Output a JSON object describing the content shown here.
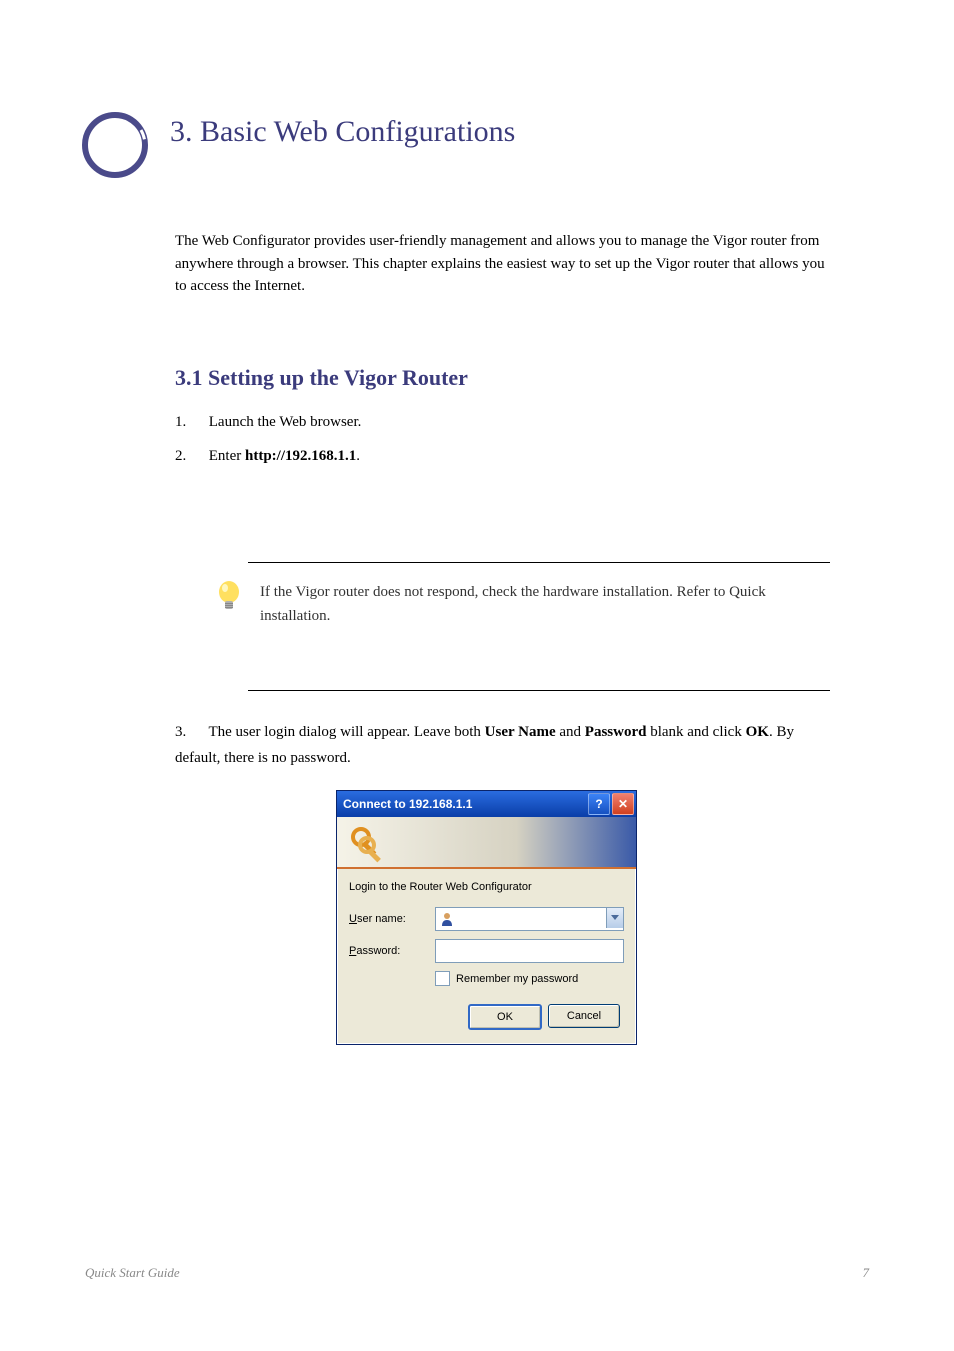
{
  "section_number": "3",
  "section_title": "Basic Web Configurations",
  "intro": "The Web Configurator provides user-friendly management and allows you to manage the Vigor router from anywhere through a browser. This chapter explains the easiest way to set up the Vigor router that allows you to access the Internet.",
  "subheading": "3.1 Setting up the Vigor Router",
  "steps": {
    "s1_num": "1.",
    "s1": "Launch the Web browser.",
    "s2_num": "2.",
    "s2_pre": "Enter ",
    "s2_ip": "http://192.168.1.1",
    "s2_post": ".",
    "s3_num": "3.",
    "s3_a": "The user login dialog will appear. Leave both ",
    "s3_b": "User Name ",
    "s3_c": "and ",
    "s3_d": "Password ",
    "s3_e": "blank and click ",
    "s3_f": "OK",
    "s3_g": ".  By default, there is no password."
  },
  "callout": "If the Vigor router does not respond, check the hardware installation. Refer to Quick installation.",
  "dialog": {
    "title": "Connect to 192.168.1.1",
    "message": "Login to the Router Web Configurator",
    "username_label_pre": "U",
    "username_label_post": "ser name:",
    "password_label_pre": "P",
    "password_label_post": "assword:",
    "remember_pre": "R",
    "remember_post": "emember my password",
    "ok": "OK",
    "cancel": "Cancel"
  },
  "footer_left": "Quick Start Guide",
  "footer_right": "7"
}
